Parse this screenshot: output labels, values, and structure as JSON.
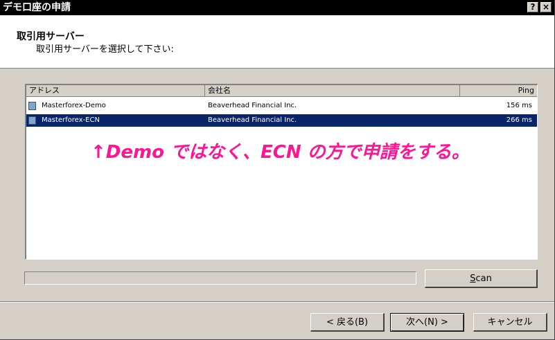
{
  "window": {
    "title": "デモ口座の申請",
    "help_label": "?",
    "close_label": "×"
  },
  "header": {
    "title": "取引用サーバー",
    "subtitle": "取引用サーバーを選択して下さい:"
  },
  "server_list": {
    "columns": [
      "アドレス",
      "会社名",
      "Ping"
    ],
    "rows": [
      {
        "address": "Masterforex-Demo",
        "company": "Beaverhead Financial Inc.",
        "ping": "156 ms",
        "selected": false
      },
      {
        "address": "Masterforex-ECN",
        "company": "Beaverhead Financial Inc.",
        "ping": "266 ms",
        "selected": true
      }
    ]
  },
  "annotation": "↑Demo ではなく、ECN の方で申請をする。",
  "scan_button": {
    "label_prefix": "",
    "label_mnemonic": "S",
    "label_rest": "can"
  },
  "footer": {
    "back_label": "< 戻る(B)",
    "next_label": "次へ(N) >",
    "cancel_label": "キャンセル"
  }
}
